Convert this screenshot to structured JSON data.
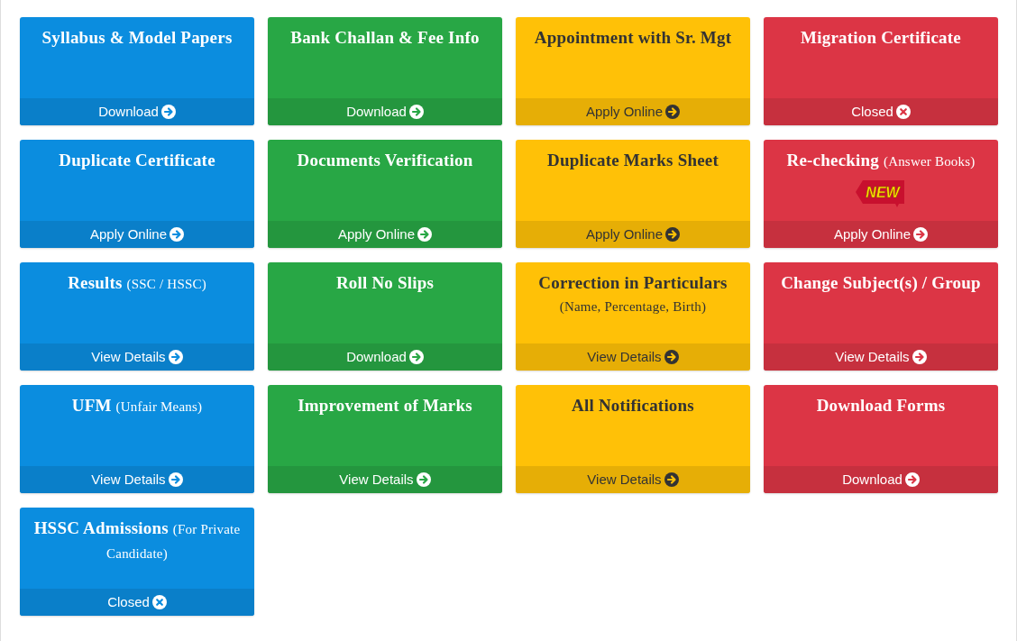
{
  "cards": [
    {
      "title": "Syllabus & Model Papers",
      "color": "#0b8ddf",
      "action": "Download",
      "kind": "arrow"
    },
    {
      "title": "Bank Challan & Fee Info",
      "color": "#28a745",
      "action": "Download",
      "kind": "arrow"
    },
    {
      "title": "Appointment with Sr. Mgt",
      "color": "#ffc107",
      "action": "Apply Online",
      "kind": "arrow"
    },
    {
      "title": "Migration Certificate",
      "color": "#dc3545",
      "action": "Closed",
      "kind": "closed"
    },
    {
      "title": "Duplicate Certificate",
      "color": "#0b8ddf",
      "action": "Apply Online",
      "kind": "arrow"
    },
    {
      "title": "Documents Verification",
      "color": "#28a745",
      "action": "Apply Online",
      "kind": "arrow"
    },
    {
      "title": "Duplicate Marks Sheet",
      "color": "#ffc107",
      "action": "Apply Online",
      "kind": "arrow"
    },
    {
      "title": "Re-checking",
      "note": "(Answer Books)",
      "badge": "NEW",
      "color": "#dc3545",
      "action": "Apply Online",
      "kind": "arrow"
    },
    {
      "title": "Results",
      "note": "(SSC / HSSC)",
      "color": "#0b8ddf",
      "action": "View Details",
      "kind": "arrow"
    },
    {
      "title": "Roll No Slips",
      "color": "#28a745",
      "action": "Download",
      "kind": "arrow"
    },
    {
      "title": "Correction in Particulars",
      "note": "(Name, Percentage, Birth)",
      "color": "#ffc107",
      "action": "View Details",
      "kind": "arrow"
    },
    {
      "title": "Change Subject(s) / Group",
      "color": "#dc3545",
      "action": "View Details",
      "kind": "arrow"
    },
    {
      "title": "UFM",
      "note": "(Unfair Means)",
      "color": "#0b8ddf",
      "action": "View Details",
      "kind": "arrow"
    },
    {
      "title": "Improvement of Marks",
      "color": "#28a745",
      "action": "View Details",
      "kind": "arrow"
    },
    {
      "title": "All Notifications",
      "color": "#ffc107",
      "action": "View Details",
      "kind": "arrow"
    },
    {
      "title": "Download Forms",
      "color": "#dc3545",
      "action": "Download",
      "kind": "arrow"
    },
    {
      "title": "HSSC Admissions",
      "note": "(For Private Candidate)",
      "color": "#0b8ddf",
      "action": "Closed",
      "kind": "closed"
    }
  ]
}
